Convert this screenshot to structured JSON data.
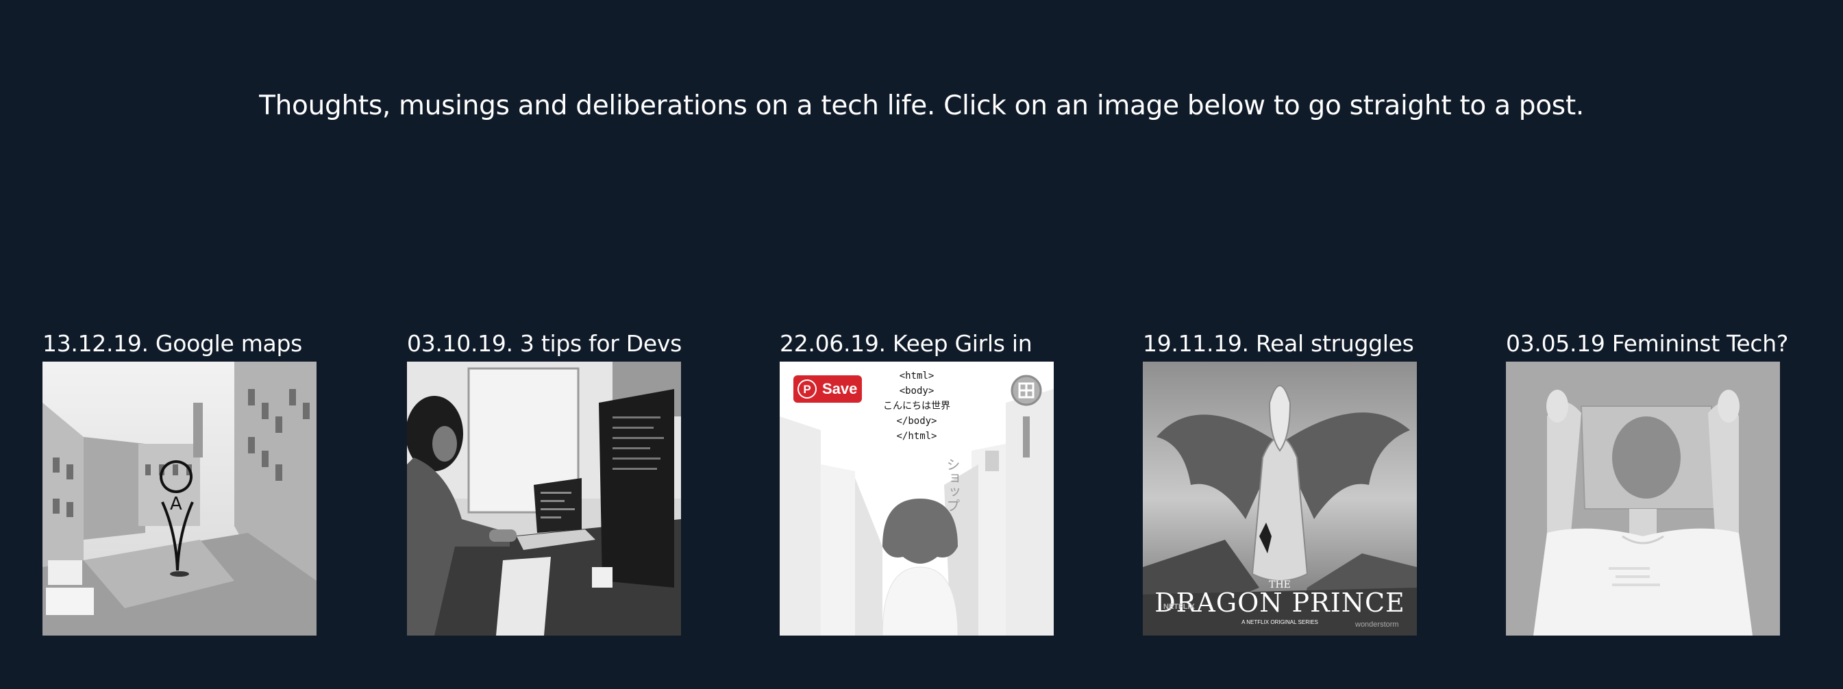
{
  "intro": {
    "tagline": "Thoughts, musings and deliberations on a tech life. Click on an image below to go straight to a post."
  },
  "posts": [
    {
      "title": "13.12.19. Google maps",
      "image_icon": "street-map-pin-photo"
    },
    {
      "title": "03.10.19. 3 tips for Devs",
      "image_icon": "developer-at-desk-photo"
    },
    {
      "title": "22.06.19. Keep Girls in",
      "image_icon": "girl-city-illustration",
      "save_label": "Save",
      "code_lines": [
        "<html>",
        "<body>",
        "こんにちは世界",
        "</body>",
        "</html>"
      ],
      "sign_text": "ショップ"
    },
    {
      "title": "19.11.19. Real struggles",
      "image_icon": "dragon-prince-poster",
      "poster_title": "DRAGON PRINCE",
      "poster_the": "THE",
      "poster_sub": "A NETFLIX ORIGINAL SERIES",
      "poster_brand_left": "NETFLIX",
      "poster_brand_right": "wonderstorm"
    },
    {
      "title": "03.05.19 Femininst Tech?",
      "image_icon": "person-holding-photo"
    }
  ],
  "colors": {
    "background": "#101b29",
    "text": "#ffffff",
    "save_button": "#d6242d"
  }
}
